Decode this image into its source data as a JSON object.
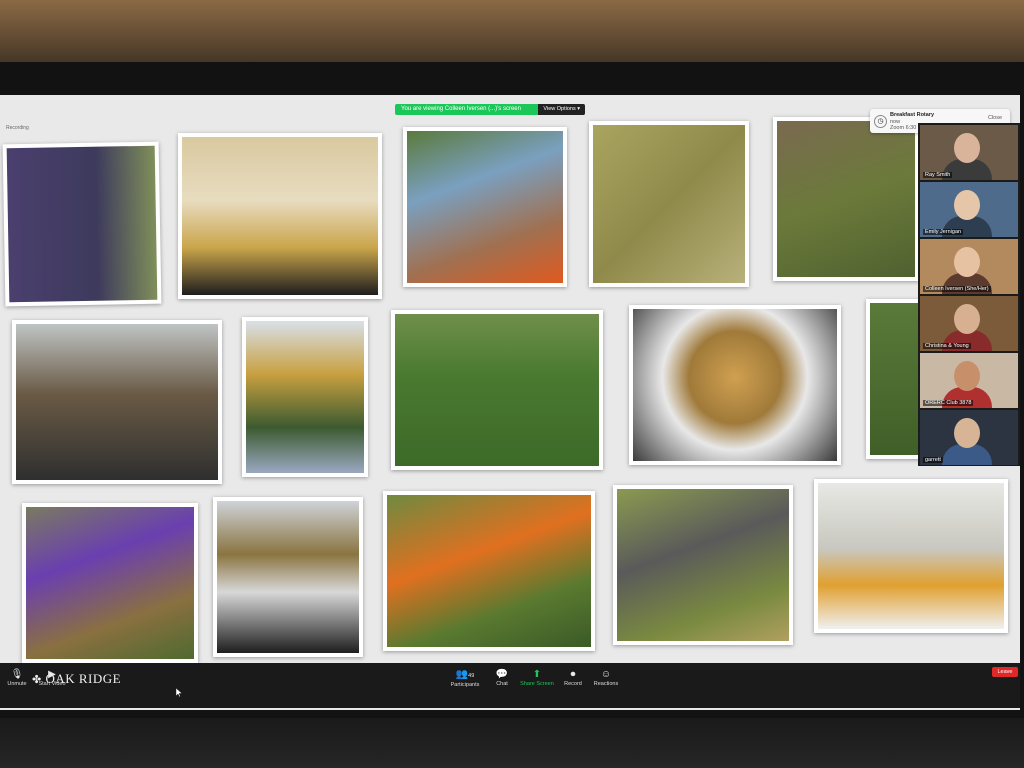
{
  "share_banner": {
    "text": "You are viewing Colleen Iversen (...)'s screen",
    "view_options": "View Options ▾"
  },
  "recording_label": "Recording",
  "notification": {
    "title": "Breakfast Rotary",
    "time": "now",
    "subtitle": "Zoom 6:30 a",
    "close": "Close"
  },
  "participants": [
    {
      "name": "Ray Smith",
      "bg": "#6b5a48",
      "skin": "#d9b49a",
      "shirt": "#3b3b3b"
    },
    {
      "name": "Emily Jernigan",
      "bg": "#4f6b8c",
      "skin": "#e6c6a8",
      "shirt": "#2c3e50"
    },
    {
      "name": "Colleen Iversen (She/Her)",
      "bg": "#b38a5e",
      "skin": "#e7c2a2",
      "shirt": "#5c3b2e"
    },
    {
      "name": "Christina & Young",
      "bg": "#7b5b3a",
      "skin": "#d6b090",
      "shirt": "#8a2b2b"
    },
    {
      "name": "ORERC Club 3878",
      "bg": "#c9b8a3",
      "skin": "#c8906a",
      "shirt": "#b03030"
    },
    {
      "name": "garrett",
      "bg": "#2b3440",
      "skin": "#d8b497",
      "shirt": "#3c5a88"
    }
  ],
  "toolbar": {
    "unmute": "Unmute",
    "start_video": "Start Video",
    "participants": "Participants",
    "participants_count": "49",
    "chat": "Chat",
    "share_screen": "Share Screen",
    "record": "Record",
    "reactions": "Reactions",
    "leave": "Leave"
  },
  "logo_text": "OAK RIDGE",
  "colors": {
    "share_green": "#1cc75a",
    "leave_red": "#e02828"
  }
}
